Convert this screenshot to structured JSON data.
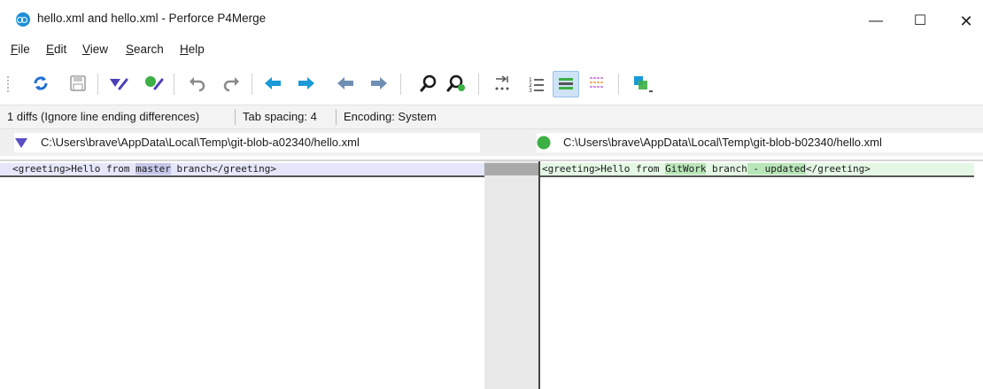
{
  "window": {
    "title": "hello.xml and hello.xml - Perforce P4Merge",
    "minimize_glyph": "—",
    "maximize_glyph": "☐",
    "close_glyph": "✕"
  },
  "menu": [
    {
      "hot": "F",
      "rest": "ile"
    },
    {
      "hot": "E",
      "rest": "dit"
    },
    {
      "hot": "V",
      "rest": "iew"
    },
    {
      "hot": "S",
      "rest": "earch"
    },
    {
      "hot": "H",
      "rest": "elp"
    }
  ],
  "toolbar_icons": [
    "refresh-icon",
    "save-icon",
    "diff-left-icon",
    "diff-right-icon",
    "undo-icon",
    "redo-icon",
    "next-diff-icon",
    "prev-diff-icon",
    "next-change-icon",
    "prev-change-icon",
    "find-icon",
    "find-next-icon",
    "show-whitespace-icon",
    "line-numbers-icon",
    "line-highlight-icon",
    "inline-diff-icon",
    "layout-icon"
  ],
  "status": {
    "diffs": "1 diffs (Ignore line ending differences)",
    "tab_spacing": "Tab spacing: 4",
    "encoding": "Encoding: System"
  },
  "left_file": {
    "path": "C:\\Users\\brave\\AppData\\Local\\Temp\\git-blob-a02340/hello.xml",
    "marker_color": "#5b4fc4",
    "line": {
      "before": "<greeting>Hello from ",
      "changed": "master",
      "after": " branch</greeting>"
    }
  },
  "right_file": {
    "path": "C:\\Users\\brave\\AppData\\Local\\Temp\\git-blob-b02340/hello.xml",
    "marker_color": "#3cb043",
    "line": {
      "before": "<greeting>Hello from ",
      "changed1": "GitWork",
      "mid": " branch",
      "changed2": " - updated",
      "after": "</greeting>"
    }
  }
}
